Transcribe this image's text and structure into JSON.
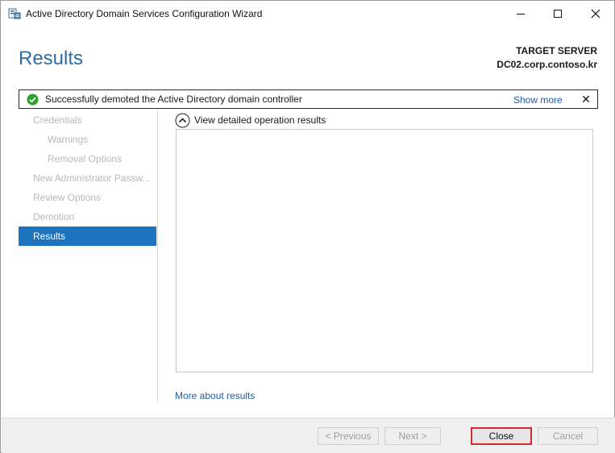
{
  "window": {
    "title": "Active Directory Domain Services Configuration Wizard",
    "controls": {
      "minimize": "minimize",
      "maximize": "maximize",
      "close": "close"
    }
  },
  "header": {
    "title": "Results",
    "target_label": "TARGET SERVER",
    "target_server": "DC02.corp.contoso.kr"
  },
  "banner": {
    "status": "success",
    "message": "Successfully demoted the Active Directory domain controller",
    "show_more": "Show more",
    "close": "✕"
  },
  "nav": {
    "items": [
      {
        "label": "Credentials",
        "level": 1,
        "active": false
      },
      {
        "label": "Warnings",
        "level": 2,
        "active": false
      },
      {
        "label": "Removal Options",
        "level": 2,
        "active": false
      },
      {
        "label": "New Administrator Passw...",
        "level": 1,
        "active": false
      },
      {
        "label": "Review Options",
        "level": 1,
        "active": false
      },
      {
        "label": "Demotion",
        "level": 1,
        "active": false
      },
      {
        "label": "Results",
        "level": 1,
        "active": true
      }
    ]
  },
  "main": {
    "toggle_label": "View detailed operation results",
    "results_text": "",
    "more_link": "More about results"
  },
  "footer": {
    "previous": "< Previous",
    "next": "Next >",
    "close": "Close",
    "cancel": "Cancel"
  },
  "colors": {
    "accent": "#1e73be",
    "title_blue": "#2e6da4",
    "link": "#1f5fa8",
    "success": "#2ca02c",
    "focus_border": "#d6262f"
  },
  "icons": {
    "app": "server-manager-icon",
    "banner_status": "success-check-icon",
    "toggle": "chevron-up-circle-icon"
  }
}
